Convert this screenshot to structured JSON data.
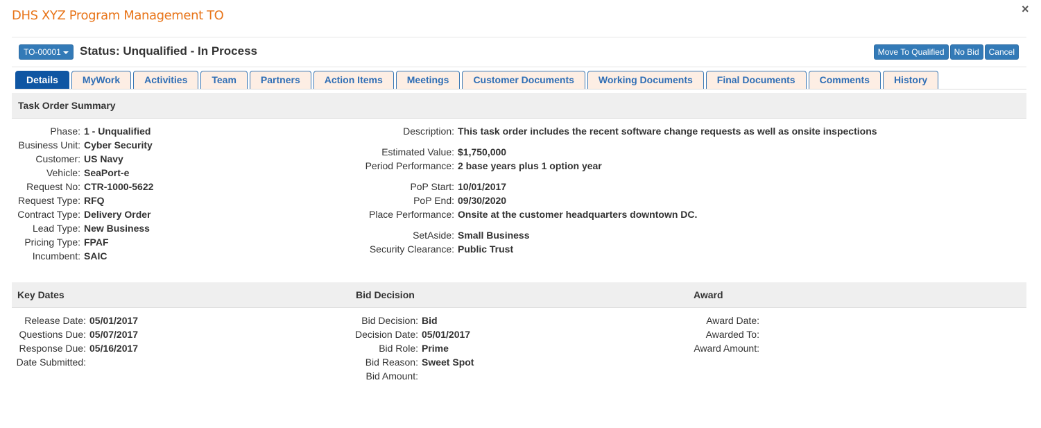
{
  "window": {
    "title": "DHS XYZ Program Management TO",
    "close_icon": "×"
  },
  "header": {
    "to_number": "TO-00001",
    "status": "Status: Unqualified - In Process",
    "actions": {
      "move_to_qualified": "Move To Qualified",
      "no_bid": "No Bid",
      "cancel": "Cancel"
    },
    "accent_color": "#337ab7",
    "title_color": "#e8751a"
  },
  "tabs": [
    {
      "label": "Details",
      "active": true
    },
    {
      "label": "MyWork",
      "active": false
    },
    {
      "label": "Activities",
      "active": false
    },
    {
      "label": "Team",
      "active": false
    },
    {
      "label": "Partners",
      "active": false
    },
    {
      "label": "Action Items",
      "active": false
    },
    {
      "label": "Meetings",
      "active": false
    },
    {
      "label": "Customer Documents",
      "active": false
    },
    {
      "label": "Working Documents",
      "active": false
    },
    {
      "label": "Final Documents",
      "active": false
    },
    {
      "label": "Comments",
      "active": false
    },
    {
      "label": "History",
      "active": false
    }
  ],
  "summary": {
    "heading": "Task Order Summary",
    "left": [
      {
        "label": "Phase:",
        "value": "1 - Unqualified"
      },
      {
        "label": "Business Unit:",
        "value": "Cyber Security"
      },
      {
        "label": "Customer:",
        "value": "US Navy"
      },
      {
        "label": "Vehicle:",
        "value": "SeaPort-e"
      },
      {
        "label": "Request No:",
        "value": "CTR-1000-5622"
      },
      {
        "label": "Request Type:",
        "value": "RFQ"
      },
      {
        "label": "Contract Type:",
        "value": "Delivery Order"
      },
      {
        "label": "Lead Type:",
        "value": "New Business"
      },
      {
        "label": "Pricing Type:",
        "value": "FPAF"
      },
      {
        "label": "Incumbent:",
        "value": "SAIC"
      }
    ],
    "right": [
      {
        "label": "Description:",
        "value": "This task order includes the recent software change requests as well as onsite inspections"
      },
      {
        "label": "Estimated Value:",
        "value": "$1,750,000"
      },
      {
        "label": "Period Performance:",
        "value": "2 base years plus 1 option year"
      },
      {
        "label": "PoP Start:",
        "value": "10/01/2017"
      },
      {
        "label": "PoP End:",
        "value": "09/30/2020"
      },
      {
        "label": "Place Performance:",
        "value": "Onsite at the customer headquarters downtown DC."
      },
      {
        "label": "SetAside:",
        "value": "Small Business"
      },
      {
        "label": "Security Clearance:",
        "value": "Public Trust"
      }
    ]
  },
  "key_dates": {
    "heading": "Key Dates",
    "rows": [
      {
        "label": "Release Date:",
        "value": "05/01/2017"
      },
      {
        "label": "Questions Due:",
        "value": "05/07/2017"
      },
      {
        "label": "Response Due:",
        "value": "05/16/2017"
      },
      {
        "label": "Date Submitted:",
        "value": ""
      }
    ]
  },
  "bid_decision": {
    "heading": "Bid Decision",
    "rows": [
      {
        "label": "Bid Decision:",
        "value": "Bid"
      },
      {
        "label": "Decision Date:",
        "value": "05/01/2017"
      },
      {
        "label": "Bid Role:",
        "value": "Prime"
      },
      {
        "label": "Bid Reason:",
        "value": "Sweet Spot"
      },
      {
        "label": "Bid Amount:",
        "value": ""
      }
    ]
  },
  "award": {
    "heading": "Award",
    "rows": [
      {
        "label": "Award Date:",
        "value": ""
      },
      {
        "label": "Awarded To:",
        "value": ""
      },
      {
        "label": "Award Amount:",
        "value": ""
      }
    ]
  }
}
